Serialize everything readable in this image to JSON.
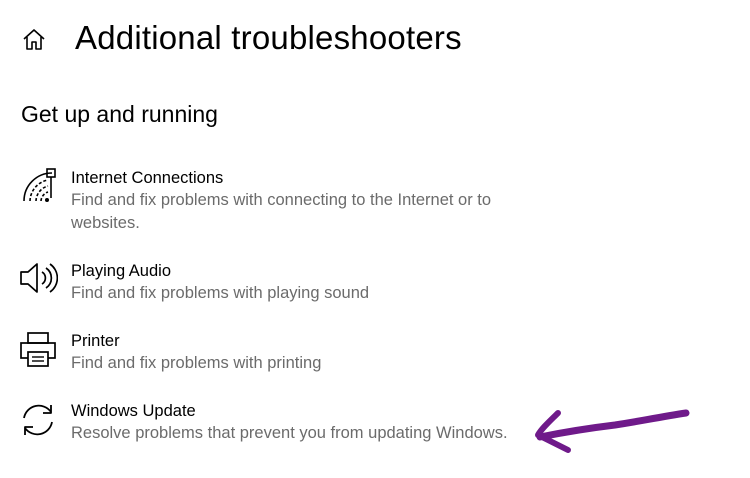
{
  "header": {
    "home_icon": "home-icon",
    "title": "Additional troubleshooters"
  },
  "section": {
    "heading": "Get up and running"
  },
  "items": [
    {
      "icon": "network-wifi-icon",
      "title": "Internet Connections",
      "description": "Find and fix problems with connecting to the Internet or to websites."
    },
    {
      "icon": "speaker-icon",
      "title": "Playing Audio",
      "description": "Find and fix problems with playing sound"
    },
    {
      "icon": "printer-icon",
      "title": "Printer",
      "description": "Find and fix problems with printing"
    },
    {
      "icon": "sync-icon",
      "title": "Windows Update",
      "description": "Resolve problems that prevent you from updating Windows."
    }
  ],
  "annotation": {
    "icon": "arrow-annotation-icon",
    "color": "#6f1a8a"
  }
}
